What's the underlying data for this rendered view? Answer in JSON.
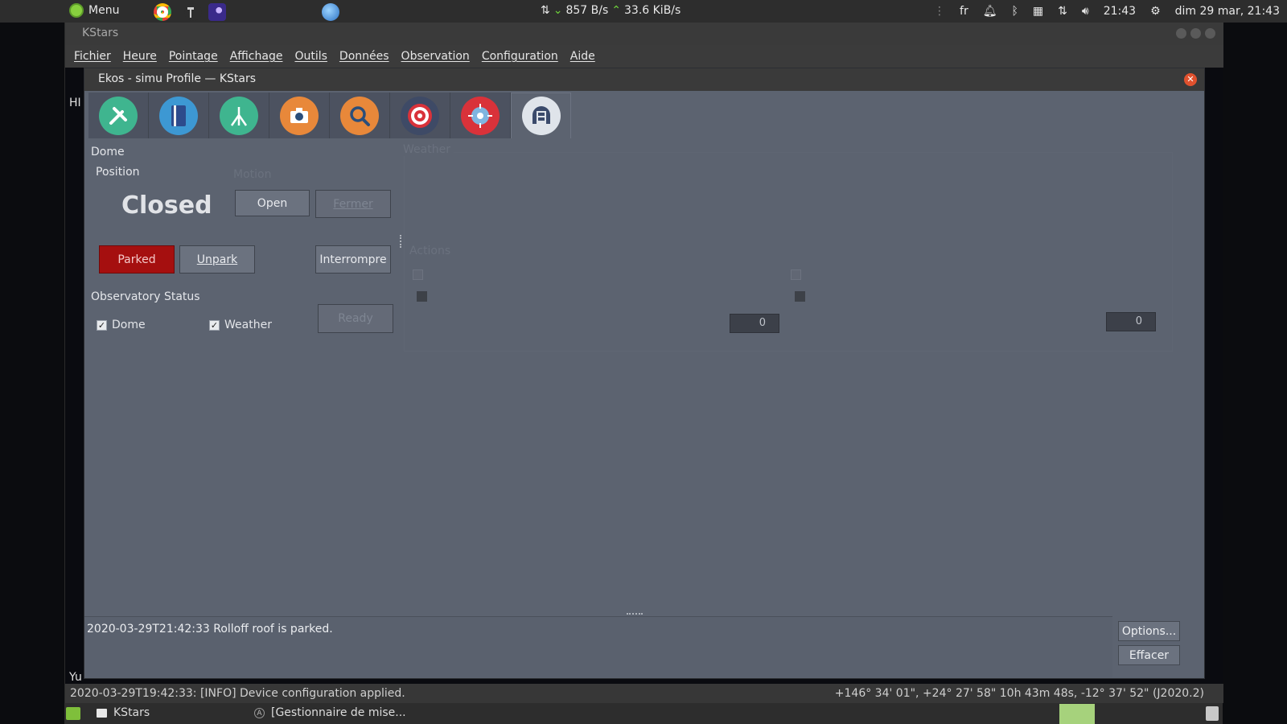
{
  "top_panel": {
    "menu_label": "Menu",
    "net_down": "857 B/s",
    "net_up": "33.6 KiB/s",
    "lang": "fr",
    "time": "21:43",
    "date": "dim 29 mar, 21:43"
  },
  "kstars": {
    "title": "KStars",
    "menus": [
      "Fichier",
      "Heure",
      "Pointage",
      "Affichage",
      "Outils",
      "Données",
      "Observation",
      "Configuration",
      "Aide"
    ],
    "sky_text_top": "HI",
    "sky_text_bottom": "Yu",
    "status_message": "2020-03-29T19:42:33: [INFO] Device configuration applied.",
    "status_coords": "+146° 34' 01\", +24° 27' 58\"  10h 43m 48s, -12° 37' 52\" (J2020.2)"
  },
  "ekos": {
    "title": "Ekos - simu Profile — KStars",
    "tabs": [
      {
        "name": "setup",
        "icon": "wrench-screwdriver-icon",
        "color": "#3fb58f"
      },
      {
        "name": "scheduler",
        "icon": "notebook-icon",
        "color": "#3d98d3"
      },
      {
        "name": "mount",
        "icon": "telescope-tripod-icon",
        "color": "#3fb58f"
      },
      {
        "name": "capture",
        "icon": "camera-icon",
        "color": "#e8883a"
      },
      {
        "name": "focus",
        "icon": "magnifier-icon",
        "color": "#e8883a"
      },
      {
        "name": "align",
        "icon": "target-icon",
        "color": "#d9323a"
      },
      {
        "name": "guide",
        "icon": "guide-crosshair-icon",
        "color": "#d9323a"
      },
      {
        "name": "observatory",
        "icon": "dome-icon",
        "color": "#3a4a6b"
      }
    ],
    "dome": {
      "group_title": "Dome",
      "position_title": "Position",
      "motion_ghost": "Motion",
      "status": "Closed",
      "open_label": "Open",
      "close_label": "Fermer",
      "parked_label": "Parked",
      "unpark_label": "Unpark",
      "abort_label": "Interrompre"
    },
    "observatory_status": {
      "title": "Observatory Status",
      "dome_label": "Dome",
      "weather_label": "Weather",
      "ready_label": "Ready"
    },
    "weather": {
      "title_ghost": "Weather",
      "actions_ghost": "Actions",
      "warning_value": "0",
      "alert_value": "0"
    },
    "log": {
      "message": "2020-03-29T21:42:33 Rolloff roof is parked.",
      "options_label": "Options...",
      "clear_label": "Effacer"
    }
  },
  "taskbar": {
    "kstars_label": "KStars",
    "update_label": "[Gestionnaire de mise..."
  }
}
